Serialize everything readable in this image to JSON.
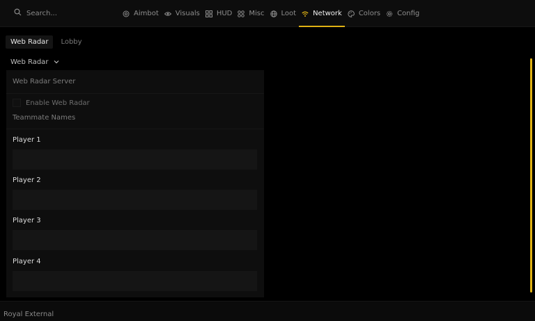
{
  "search": {
    "placeholder": "Search..."
  },
  "nav": {
    "items": [
      {
        "label": "Aimbot",
        "icon": "crosshair-icon"
      },
      {
        "label": "Visuals",
        "icon": "eye-icon"
      },
      {
        "label": "HUD",
        "icon": "grid-icon"
      },
      {
        "label": "Misc",
        "icon": "apps-icon"
      },
      {
        "label": "Loot",
        "icon": "globe-icon"
      },
      {
        "label": "Network",
        "icon": "wifi-icon",
        "active": true
      },
      {
        "label": "Colors",
        "icon": "palette-icon"
      },
      {
        "label": "Config",
        "icon": "gear-icon"
      }
    ],
    "accent": "#e0b214"
  },
  "subtabs": [
    {
      "label": "Web Radar",
      "active": true
    },
    {
      "label": "Lobby",
      "active": false
    }
  ],
  "section_dropdown": {
    "label": "Web Radar"
  },
  "panel": {
    "header": "Web Radar Server",
    "enable_label": "Enable Web Radar",
    "enable_checked": false,
    "teammate_label": "Teammate Names",
    "players": [
      {
        "label": "Player 1",
        "value": ""
      },
      {
        "label": "Player 2",
        "value": ""
      },
      {
        "label": "Player 3",
        "value": ""
      },
      {
        "label": "Player 4",
        "value": ""
      }
    ]
  },
  "footer": {
    "label": "Royal External"
  }
}
